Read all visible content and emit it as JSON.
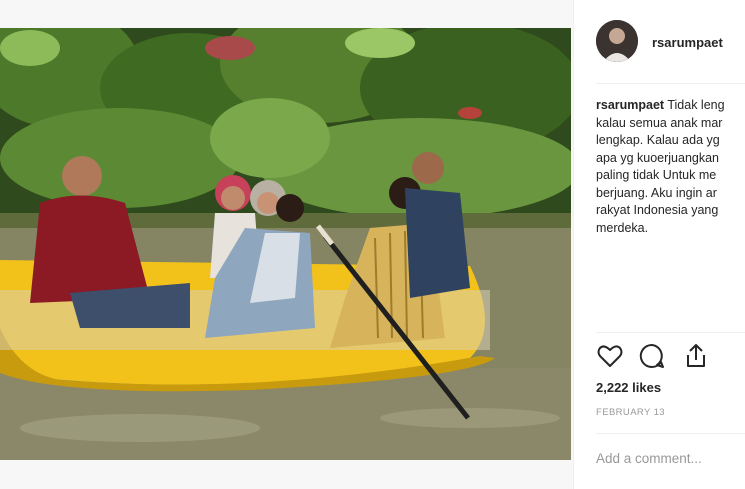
{
  "post": {
    "username": "rsarumpaet",
    "separator": "•",
    "caption_user": "rsarumpaet",
    "caption_lines": [
      "Tidak leng",
      "kalau semua anak mar",
      "lengkap. Kalau ada yg",
      "apa yg kuoerjuangkan",
      "paling tidak Untuk me",
      "berjuang. Aku ingin ar",
      "rakyat Indonesia yang",
      "merdeka."
    ],
    "likes": "2,222 likes",
    "date": "FEBRUARY 13",
    "comment_placeholder": "Add a comment..."
  },
  "icons": {
    "like": "heart-icon",
    "comment": "comment-bubble-icon",
    "share": "share-icon"
  },
  "colors": {
    "text": "#262626",
    "muted": "#999999",
    "boat": "#f2c21b",
    "water": "#7f8060"
  }
}
